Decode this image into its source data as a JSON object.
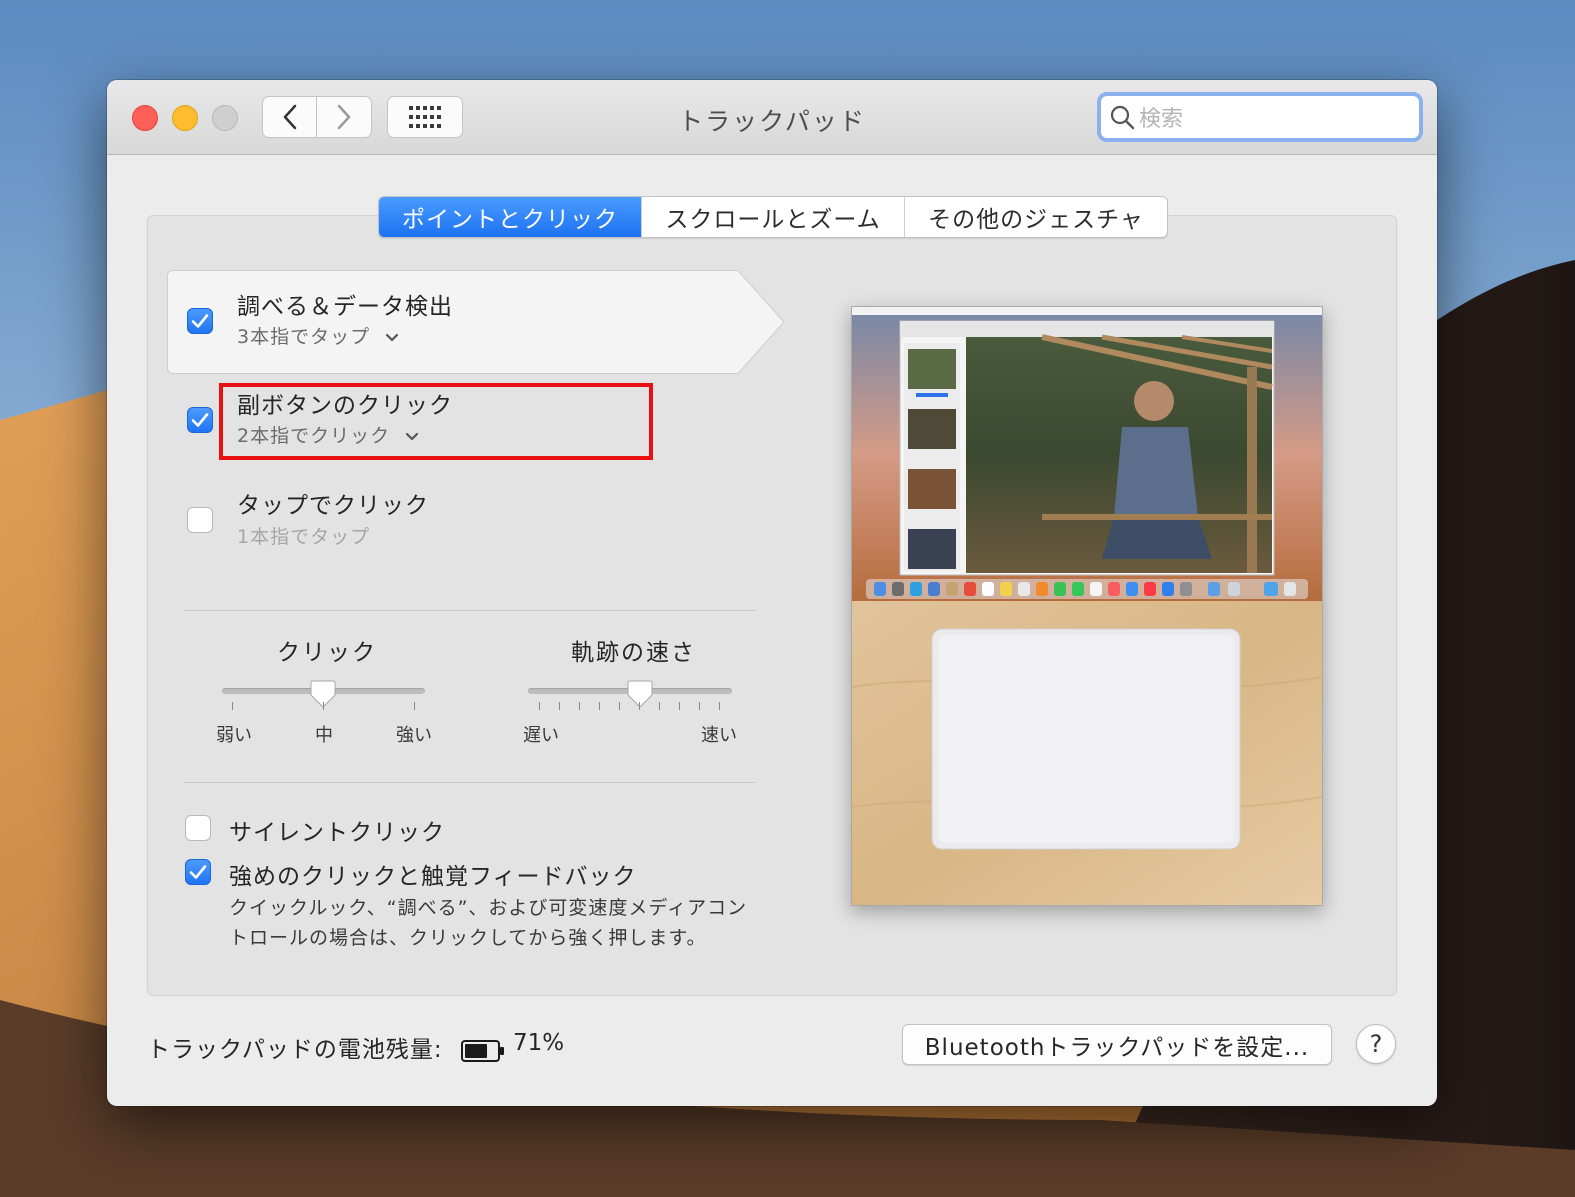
{
  "window": {
    "title": "トラックパッド",
    "search_placeholder": "検索"
  },
  "tabs": [
    {
      "label": "ポイントとクリック",
      "active": true
    },
    {
      "label": "スクロールとズーム",
      "active": false
    },
    {
      "label": "その他のジェスチャ",
      "active": false
    }
  ],
  "options": [
    {
      "title": "調べる＆データ検出",
      "subtitle": "3本指でタップ",
      "checked": true,
      "has_dropdown": true
    },
    {
      "title": "副ボタンのクリック",
      "subtitle": "2本指でクリック",
      "checked": true,
      "has_dropdown": true
    },
    {
      "title": "タップでクリック",
      "subtitle": "1本指でタップ",
      "checked": false,
      "has_dropdown": false
    }
  ],
  "sliders": {
    "click": {
      "label": "クリック",
      "min_label": "弱い",
      "mid_label": "中",
      "max_label": "強い",
      "value": "中"
    },
    "speed": {
      "label": "軌跡の速さ",
      "min_label": "遅い",
      "max_label": "速い",
      "value_fraction": 0.55
    }
  },
  "bottom_options": {
    "silent_click": {
      "label": "サイレントクリック",
      "checked": false
    },
    "force_click": {
      "label": "強めのクリックと触覚フィードバック",
      "checked": true,
      "description_line1": "クイックルック、“調べる”、および可変速度メディアコン",
      "description_line2": "トロールの場合は、クリックしてから強く押します。"
    }
  },
  "battery": {
    "label": "トラックパッドの電池残量:",
    "percent": "71%",
    "level": 0.71
  },
  "buttons": {
    "bluetooth": "Bluetoothトラックパッドを設定...",
    "help": "?"
  },
  "colors": {
    "accent": "#1d72f2",
    "highlight_box": "#e81010"
  },
  "icons": [
    "close-icon",
    "minimize-icon",
    "zoom-icon",
    "back-chevron-icon",
    "forward-chevron-icon",
    "grid-icon",
    "search-icon",
    "checkmark-icon",
    "chevron-down-icon",
    "battery-icon"
  ]
}
